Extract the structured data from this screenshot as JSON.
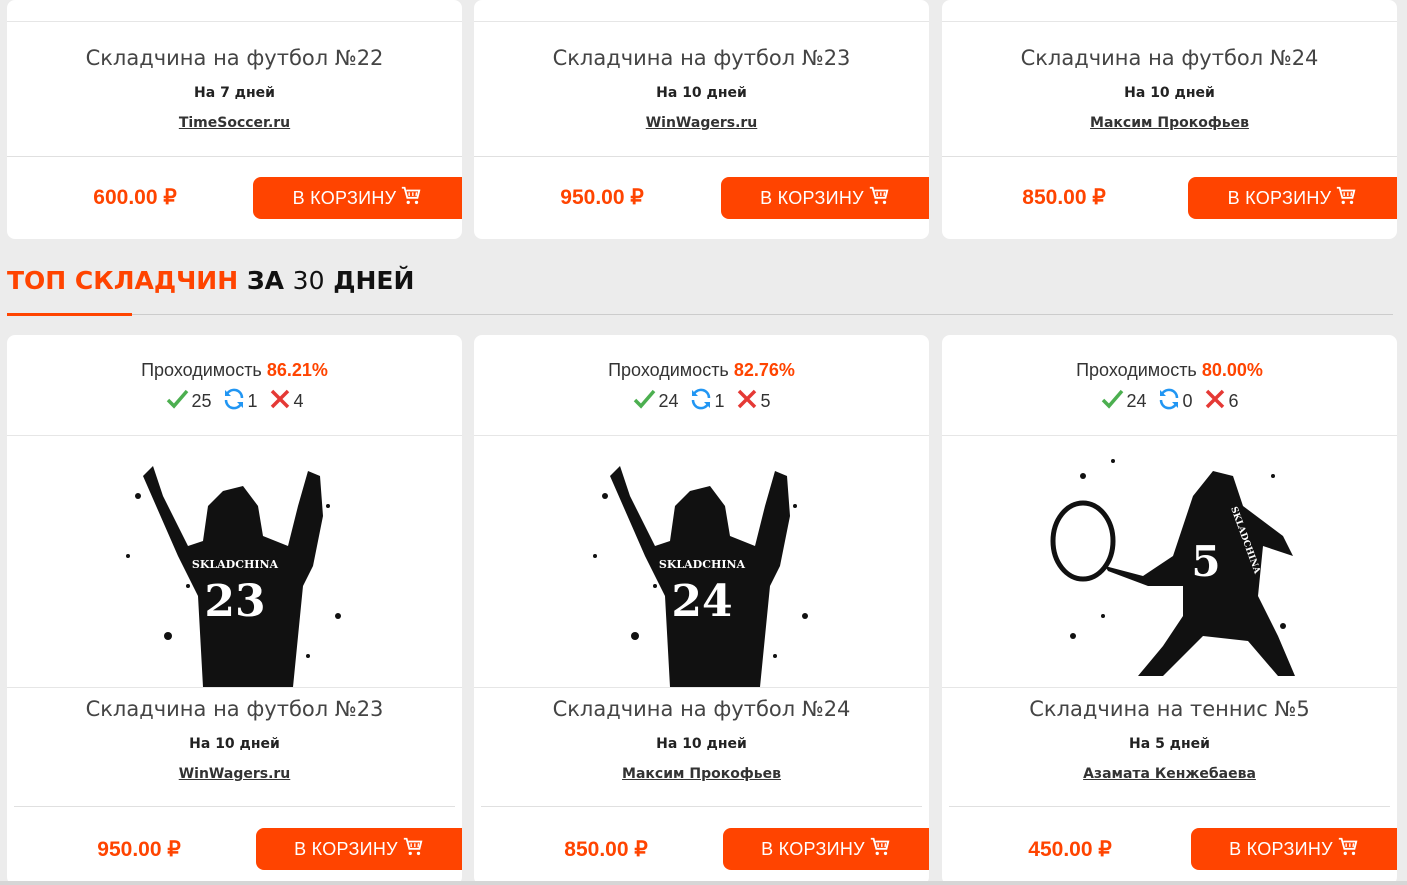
{
  "cart_label": "В КОРЗИНУ",
  "top_cards": [
    {
      "title": "Складчина на футбол №22",
      "days": "На 7 дней",
      "author": "TimeSoccer.ru",
      "price": "600.00 ₽"
    },
    {
      "title": "Складчина на футбол №23",
      "days": "На 10 дней",
      "author": "WinWagers.ru",
      "price": "950.00 ₽"
    },
    {
      "title": "Складчина на футбол №24",
      "days": "На 10 дней",
      "author": "Максим Прокофьев",
      "price": "850.00 ₽"
    }
  ],
  "section": {
    "accent": "ТОП СКЛАДЧИН",
    "mid": " ЗА ",
    "num": "30",
    "end": " ДНЕЙ"
  },
  "pass_label": "Проходимость",
  "bottom_cards": [
    {
      "pass": "86.21%",
      "ok": "25",
      "pending": "1",
      "fail": "4",
      "jersey_text": "SKLADCHINA",
      "jersey_number": "23",
      "title": "Складчина на футбол №23",
      "days": "На 10 дней",
      "author": "WinWagers.ru",
      "price": "950.00 ₽"
    },
    {
      "pass": "82.76%",
      "ok": "24",
      "pending": "1",
      "fail": "5",
      "jersey_text": "SKLADCHINA",
      "jersey_number": "24",
      "title": "Складчина на футбол №24",
      "days": "На 10 дней",
      "author": "Максим Прокофьев",
      "price": "850.00 ₽"
    },
    {
      "pass": "80.00%",
      "ok": "24",
      "pending": "0",
      "fail": "6",
      "jersey_text": "SKLADCHINA",
      "jersey_number": "5",
      "title": "Складчина на теннис №5",
      "days": "На 5 дней",
      "author": "Азамата Кенжебаева",
      "price": "450.00 ₽"
    }
  ],
  "colors": {
    "accent": "#ff4400",
    "check": "#4caf50",
    "refresh": "#2196f3",
    "cross": "#e53935"
  }
}
